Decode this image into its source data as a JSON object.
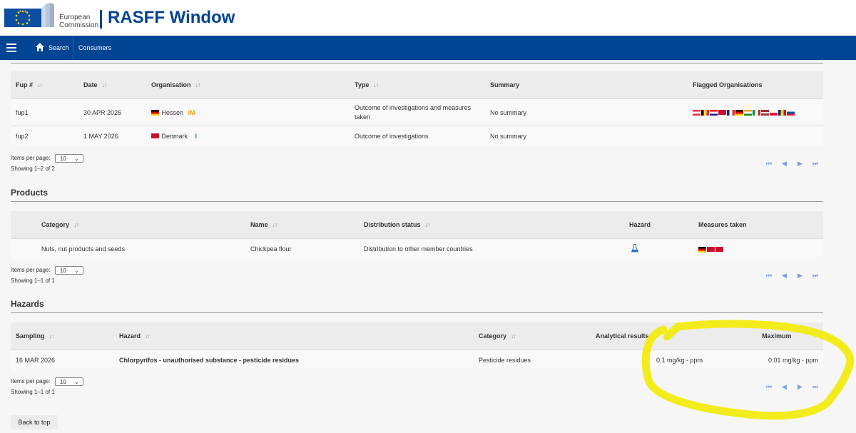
{
  "header": {
    "org_line1": "European",
    "org_line2": "Commission",
    "app_title": "RASFF Window"
  },
  "nav": {
    "search_label": "Search",
    "consumers_label": "Consumers"
  },
  "followups": {
    "columns": [
      "Fup #",
      "Date",
      "Organisation",
      "Type",
      "Summary",
      "Flagged Organisations"
    ],
    "rows": [
      {
        "fup": "fup1",
        "date": "30 APR 2026",
        "organisation": "Hessen",
        "org_badge": "IM",
        "type": "Outcome of investigations and measures taken",
        "summary": "No summary"
      },
      {
        "fup": "fup2",
        "date": "1 MAY 2026",
        "organisation": "Denmark",
        "org_badge": "I",
        "type": "Outcome of investigations",
        "summary": "No summary"
      }
    ],
    "items_per_page_label": "Items per page:",
    "items_per_page_value": "10",
    "showing": "Showing 1–2 of 2"
  },
  "products": {
    "section_title": "Products",
    "columns": [
      "Category",
      "Name",
      "Distribution status",
      "Hazard",
      "Measures taken"
    ],
    "rows": [
      {
        "category": "Nuts, nut products and seeds",
        "name": "Chickpea flour",
        "distribution": "Distribution to other member countries"
      }
    ],
    "items_per_page_label": "Items per page:",
    "items_per_page_value": "10",
    "showing": "Showing 1–1 of 1"
  },
  "hazards": {
    "section_title": "Hazards",
    "columns": [
      "Sampling",
      "Hazard",
      "Category",
      "Analytical results",
      "Maximum"
    ],
    "rows": [
      {
        "sampling": "16 MAR 2026",
        "hazard": "Chlorpyrifos - unauthorised substance - pesticide residues",
        "category": "Pesticide residues",
        "analytical": "0.1 mg/kg - ppm",
        "maximum": "0.01 mg/kg - ppm"
      }
    ],
    "items_per_page_label": "Items per page:",
    "items_per_page_value": "10",
    "showing": "Showing 1–1 of 1"
  },
  "back_to_top": "Back to top",
  "colors": {
    "brand_blue": "#004494",
    "badge_orange": "#f29d1a",
    "badge_blue": "#2e6fd0",
    "pager_blue": "#7b9fd4",
    "highlight_yellow": "#f3ec1c"
  }
}
